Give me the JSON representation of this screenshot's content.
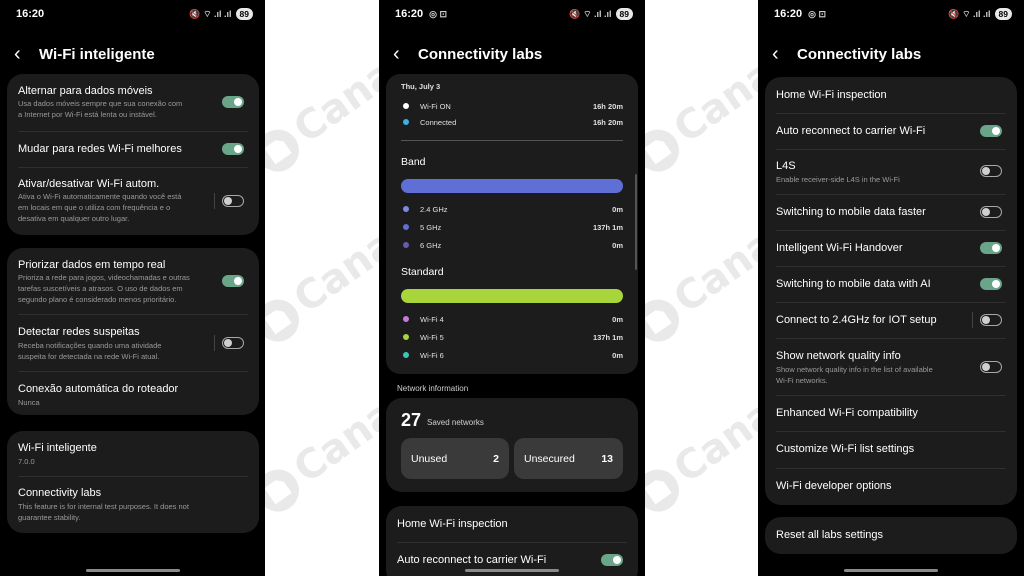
{
  "status": {
    "time": "16:20",
    "battery": "89",
    "icons": "🔇 ⌔ .ıl .ıl"
  },
  "watermark": "Canaltech",
  "colors": {
    "toggle_on": "#6aa58a",
    "band_bar": "#5f6fd6",
    "standard_bar": "#a9d53c"
  },
  "panel1": {
    "title": "Wi-Fi inteligente",
    "card1": [
      {
        "title": "Alternar para dados móveis",
        "sub": [
          "Usa dados móveis sempre que sua conexão com",
          "a Internet por Wi-Fi está lenta ou instável."
        ],
        "toggle": "on"
      },
      {
        "title": "Mudar para redes Wi-Fi melhores",
        "toggle": "on"
      },
      {
        "title": "Ativar/desativar Wi-Fi autom.",
        "sub": [
          "Ativa o Wi-Fi automaticamente quando você está",
          "em locais em que o utiliza com frequência e o",
          "desativa em qualquer outro lugar."
        ],
        "toggle": "off"
      }
    ],
    "card2": [
      {
        "title": "Priorizar dados em tempo real",
        "sub": [
          "Prioriza a rede para jogos, videochamadas e outras",
          "tarefas suscetíveis a atrasos. O uso de dados em",
          "segundo plano é considerado menos prioritário."
        ],
        "toggle": "on"
      },
      {
        "title": "Detectar redes suspeitas",
        "sub": [
          "Receba notificações quando uma atividade",
          "suspeita for detectada na rede Wi-Fi atual."
        ],
        "toggle": "off"
      },
      {
        "title": "Conexão automática do roteador",
        "sub": [
          "Nunca"
        ]
      }
    ],
    "card3": [
      {
        "title": "Wi-Fi inteligente",
        "sub": [
          "7.0.0"
        ]
      },
      {
        "title": "Connectivity labs",
        "sub": [
          "This feature is for internal test purposes. It does not",
          "guarantee stability."
        ]
      }
    ]
  },
  "panel2": {
    "title": "Connectivity labs",
    "date": "Thu, July 3",
    "wifi_stats": [
      {
        "label": "Wi-Fi ON",
        "value": "16h 20m",
        "color": "#ffffff"
      },
      {
        "label": "Connected",
        "value": "16h 20m",
        "color": "#3ab0e6"
      }
    ],
    "band": {
      "label": "Band",
      "items": [
        {
          "label": "2.4 GHz",
          "value": "0m",
          "color": "#7a8ae6"
        },
        {
          "label": "5 GHz",
          "value": "137h 1m",
          "color": "#5f6fd6"
        },
        {
          "label": "6 GHz",
          "value": "0m",
          "color": "#6a5aaa"
        }
      ]
    },
    "standard": {
      "label": "Standard",
      "items": [
        {
          "label": "Wi-Fi 4",
          "value": "0m",
          "color": "#c97ad6"
        },
        {
          "label": "Wi-Fi 5",
          "value": "137h 1m",
          "color": "#a9d53c"
        },
        {
          "label": "Wi-Fi 6",
          "value": "0m",
          "color": "#3ac7b5"
        }
      ]
    },
    "network_info_label": "Network information",
    "saved_count": "27",
    "saved_label": "Saved networks",
    "unused_label": "Unused",
    "unused_value": "2",
    "unsecured_label": "Unsecured",
    "unsecured_value": "13",
    "bottom_rows": [
      {
        "title": "Home Wi-Fi inspection"
      },
      {
        "title": "Auto reconnect to carrier Wi-Fi",
        "toggle": "on"
      }
    ]
  },
  "panel3": {
    "title": "Connectivity labs",
    "rows": [
      {
        "title": "Home Wi-Fi inspection"
      },
      {
        "title": "Auto reconnect to carrier Wi-Fi",
        "toggle": "on"
      },
      {
        "title": "L4S",
        "sub": [
          "Enable receiver-side L4S in the Wi-Fi"
        ],
        "toggle": "off"
      },
      {
        "title": "Switching to mobile data faster",
        "toggle": "off"
      },
      {
        "title": "Intelligent Wi-Fi Handover",
        "toggle": "on"
      },
      {
        "title": "Switching to mobile data with AI",
        "toggle": "on"
      },
      {
        "title": "Connect to 2.4GHz for IOT setup",
        "toggle": "off"
      },
      {
        "title": "Show network quality info",
        "sub": [
          "Show network quality info in the list of available",
          "Wi-Fi networks."
        ],
        "toggle": "off"
      },
      {
        "title": "Enhanced Wi-Fi compatibility"
      },
      {
        "title": "Customize Wi-Fi list settings"
      },
      {
        "title": "Wi-Fi developer options"
      }
    ],
    "reset_label": "Reset all labs settings"
  }
}
